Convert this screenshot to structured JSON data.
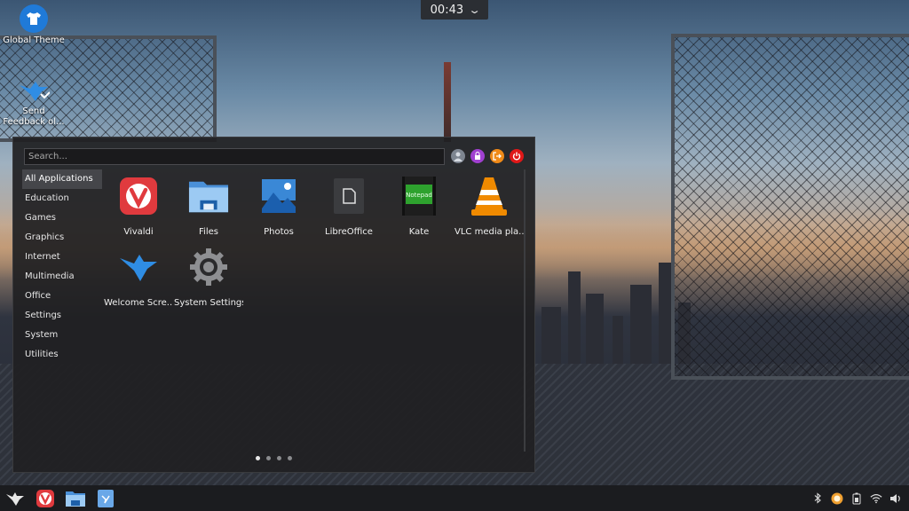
{
  "desktop": {
    "icons": [
      {
        "label": "Global Theme"
      },
      {
        "label_line1": "Send",
        "label_line2": "Feedback ol..."
      }
    ]
  },
  "clock": {
    "time": "00:43",
    "chevron": "⌄"
  },
  "launcher": {
    "search_placeholder": "Search...",
    "actions": [
      {
        "icon": "user-avatar-icon"
      },
      {
        "icon": "lock-icon",
        "color": "#a040d0"
      },
      {
        "icon": "logout-icon",
        "color": "#f08a18"
      },
      {
        "icon": "power-icon",
        "color": "#e01818"
      }
    ],
    "categories": [
      {
        "label": "All Applications"
      },
      {
        "label": "Education"
      },
      {
        "label": "Games"
      },
      {
        "label": "Graphics"
      },
      {
        "label": "Internet"
      },
      {
        "label": "Multimedia"
      },
      {
        "label": "Office"
      },
      {
        "label": "Settings"
      },
      {
        "label": "System"
      },
      {
        "label": "Utilities"
      }
    ],
    "apps": [
      {
        "label": "Vivaldi"
      },
      {
        "label": "Files"
      },
      {
        "label": "Photos"
      },
      {
        "label": "LibreOffice"
      },
      {
        "label": "Kate",
        "icon_text": "Notepad"
      },
      {
        "label": "VLC media pla..."
      },
      {
        "label": "Welcome Scre..."
      },
      {
        "label": "System Settings"
      }
    ],
    "pages": {
      "current": 1,
      "total": 4
    }
  },
  "taskbar": {
    "pinned": [
      "launcher-bird-icon",
      "vivaldi-icon",
      "files-icon",
      "feedback-icon"
    ],
    "tray": [
      "bluetooth-icon",
      "updates-icon",
      "battery-icon",
      "wifi-icon",
      "volume-icon"
    ]
  },
  "colors": {
    "accent_blue": "#1f7ad8",
    "vivaldi_red": "#e03a3e",
    "vlc_orange": "#f08a00"
  }
}
